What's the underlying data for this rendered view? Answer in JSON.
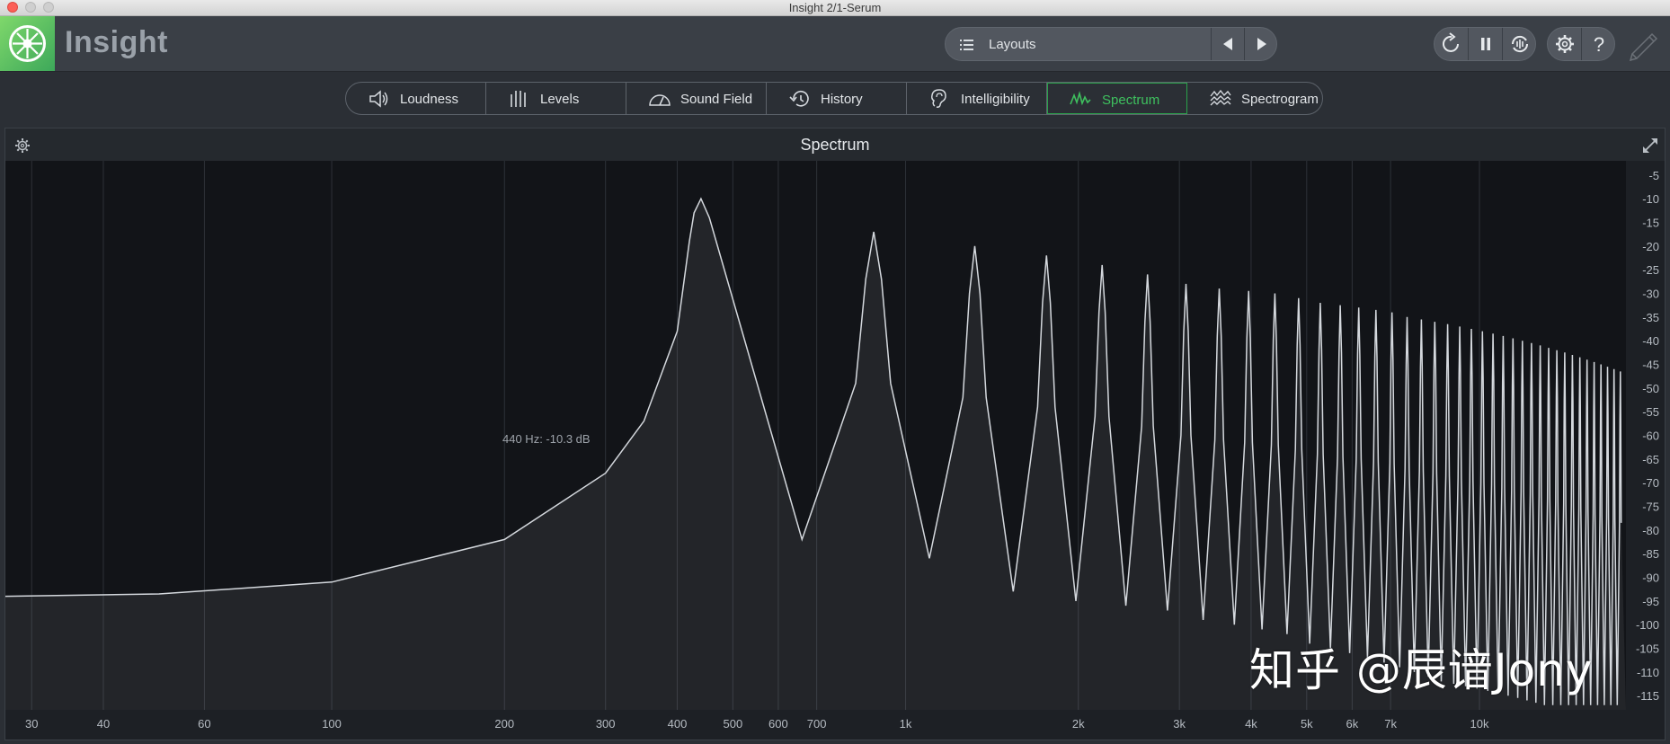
{
  "window": {
    "title": "Insight 2/1-Serum"
  },
  "app": {
    "name": "Insight",
    "accent": "#3ec05e"
  },
  "toolbar": {
    "layouts_label": "Layouts",
    "icons": [
      "list-icon",
      "prev-icon",
      "next-icon",
      "refresh-icon",
      "pause-icon",
      "sync-icon",
      "gear-icon",
      "help-icon",
      "pen-icon"
    ],
    "help_glyph": "?"
  },
  "tabs": [
    {
      "label": "Loudness",
      "icon": "speaker-icon",
      "active": false
    },
    {
      "label": "Levels",
      "icon": "levels-icon",
      "active": false
    },
    {
      "label": "Sound Field",
      "icon": "gauge-icon",
      "active": false
    },
    {
      "label": "History",
      "icon": "history-icon",
      "active": false
    },
    {
      "label": "Intelligibility",
      "icon": "ear-icon",
      "active": false
    },
    {
      "label": "Spectrum",
      "icon": "spectrum-icon",
      "active": true
    },
    {
      "label": "Spectrogram",
      "icon": "spectrogram-icon",
      "active": false
    }
  ],
  "panel": {
    "title": "Spectrum",
    "readout": "440 Hz: -10.3 dB"
  },
  "chart_data": {
    "type": "area",
    "title": "Spectrum",
    "x_scale": "log",
    "xlim": [
      27,
      18000
    ],
    "ylim": [
      -118,
      -2
    ],
    "x_tick_labels": [
      "30",
      "40",
      "60",
      "100",
      "200",
      "300",
      "400",
      "500",
      "600",
      "700",
      "1k",
      "2k",
      "3k",
      "4k",
      "5k",
      "6k",
      "7k",
      "10k"
    ],
    "x_ticks": [
      30,
      40,
      60,
      100,
      200,
      300,
      400,
      500,
      600,
      700,
      1000,
      2000,
      3000,
      4000,
      5000,
      6000,
      7000,
      10000
    ],
    "y_ticks": [
      -5,
      -10,
      -15,
      -20,
      -25,
      -30,
      -35,
      -40,
      -45,
      -50,
      -55,
      -60,
      -65,
      -70,
      -75,
      -80,
      -85,
      -90,
      -95,
      -100,
      -105,
      -110,
      -115
    ],
    "grid": true,
    "fundamental_hz": 440,
    "harmonic_peaks_db": [
      -10,
      -17,
      -20,
      -22,
      -24,
      -26,
      -28,
      -29,
      -29.5,
      -30,
      -31,
      -32,
      -32.5,
      -33,
      -33.5,
      -34,
      -35,
      -35.5,
      -36,
      -36.5,
      -37,
      -37.5,
      -38,
      -38.5,
      -39,
      -39.5,
      -40,
      -40.5,
      -41,
      -41.5,
      -42,
      -42.5,
      -43,
      -43.5,
      -44,
      -44.5,
      -45,
      -45.5,
      -46,
      -46.5
    ],
    "trough_db": [
      -82,
      -86,
      -93,
      -95,
      -96,
      -97,
      -99,
      -100,
      -101,
      -102,
      -104,
      -105,
      -106,
      -107,
      -108,
      -109,
      -110,
      -111,
      -112,
      -112.5,
      -113,
      -113.5,
      -114,
      -114.5,
      -115,
      -115.5,
      -116,
      -116.5,
      -117,
      -117,
      -117,
      -117,
      -117,
      -117,
      -117,
      -117,
      -117,
      -117,
      -117
    ],
    "low_end_db": {
      "hz": [
        27,
        50,
        100,
        200,
        300,
        350,
        400
      ],
      "db": [
        -94,
        -93.5,
        -91,
        -82,
        -68,
        -57,
        -38
      ]
    }
  },
  "watermark": "知乎 @辰谙Jony"
}
